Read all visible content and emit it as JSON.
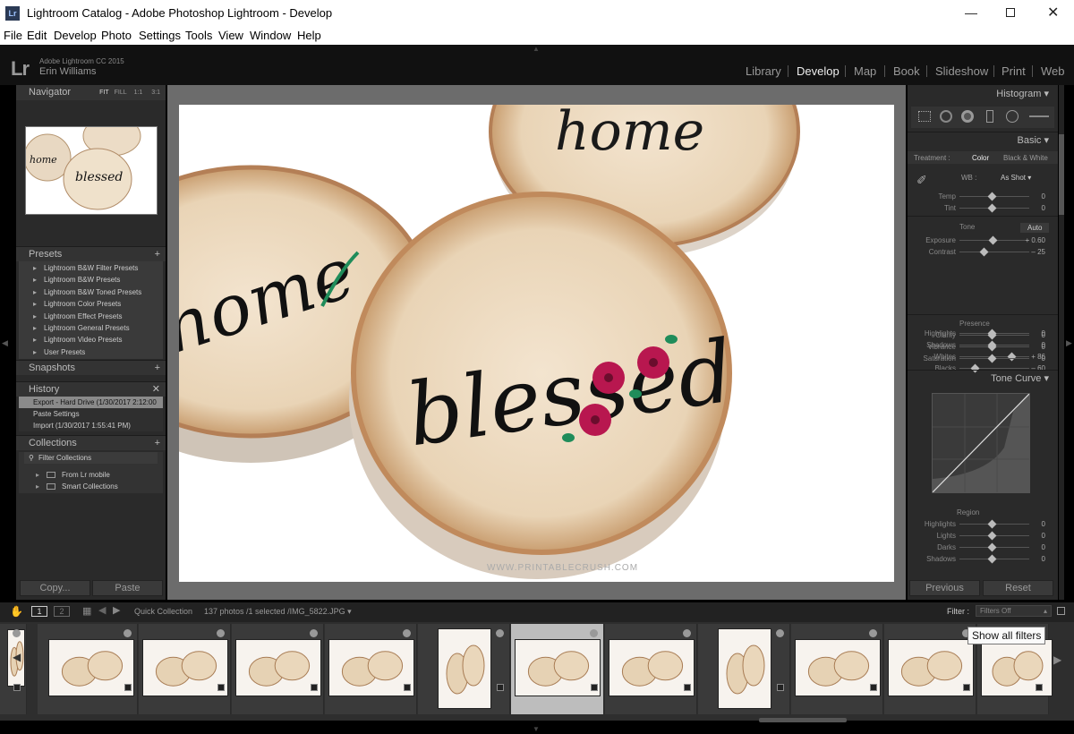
{
  "window": {
    "title": "Lightroom Catalog - Adobe Photoshop Lightroom - Develop",
    "icon_text": "Lr"
  },
  "menu": [
    "File",
    "Edit",
    "Develop",
    "Photo",
    "Settings",
    "Tools",
    "View",
    "Window",
    "Help"
  ],
  "identity": {
    "logo": "Lr",
    "version": "Adobe Lightroom CC 2015",
    "user": "Erin Williams"
  },
  "modules": [
    "Library",
    "Develop",
    "Map",
    "Book",
    "Slideshow",
    "Print",
    "Web"
  ],
  "active_module": "Develop",
  "navigator": {
    "title": "Navigator",
    "zooms": [
      "FIT",
      "FILL",
      "1:1",
      "3:1"
    ]
  },
  "presets": {
    "title": "Presets",
    "items": [
      "Lightroom B&W Filter Presets",
      "Lightroom B&W Presets",
      "Lightroom B&W Toned Presets",
      "Lightroom Color Presets",
      "Lightroom Effect Presets",
      "Lightroom General Presets",
      "Lightroom Video Presets",
      "User Presets"
    ]
  },
  "snapshots": {
    "title": "Snapshots"
  },
  "history": {
    "title": "History",
    "items": [
      "Export - Hard Drive (1/30/2017 2:12:00 ...",
      "Paste Settings",
      "Import (1/30/2017 1:55:41 PM)"
    ]
  },
  "collections": {
    "title": "Collections",
    "filter": "Filter Collections",
    "items": [
      "From Lr mobile",
      "Smart Collections"
    ]
  },
  "left_buttons": {
    "copy": "Copy...",
    "paste": "Paste"
  },
  "photo": {
    "watermark": "WWW.PRINTABLECRUSH.COM",
    "word_main": "blessed",
    "word_left": "home"
  },
  "right": {
    "histogram": "Histogram",
    "basic": "Basic",
    "treatment_label": "Treatment :",
    "treatment_color": "Color",
    "treatment_bw": "Black & White",
    "wb_label": "WB :",
    "wb_value": "As Shot",
    "tone_label": "Tone",
    "auto": "Auto",
    "presence_label": "Presence",
    "sliders_wb": [
      {
        "name": "Temp",
        "value": "0"
      },
      {
        "name": "Tint",
        "value": "0"
      }
    ],
    "sliders_tone": [
      {
        "name": "Exposure",
        "value": "+ 0.60"
      },
      {
        "name": "Contrast",
        "value": "– 25"
      },
      {
        "name": "Highlights",
        "value": "0"
      },
      {
        "name": "Shadows",
        "value": "0"
      },
      {
        "name": "Whites",
        "value": "+ 86"
      },
      {
        "name": "Blacks",
        "value": "– 60"
      }
    ],
    "sliders_presence": [
      {
        "name": "Clarity",
        "value": "0"
      },
      {
        "name": "Vibrance",
        "value": "0"
      },
      {
        "name": "Saturation",
        "value": "0"
      }
    ],
    "tone_curve": "Tone Curve",
    "region_label": "Region",
    "sliders_region": [
      {
        "name": "Highlights",
        "value": "0"
      },
      {
        "name": "Lights",
        "value": "0"
      },
      {
        "name": "Darks",
        "value": "0"
      },
      {
        "name": "Shadows",
        "value": "0"
      }
    ],
    "previous": "Previous",
    "reset": "Reset"
  },
  "filmstrip": {
    "pages": [
      "1",
      "2"
    ],
    "source": "Quick Collection",
    "info": "137 photos /1 selected /IMG_5822.JPG",
    "filter_label": "Filter :",
    "filter_value": "Filters Off",
    "tooltip": "Show all filters"
  }
}
